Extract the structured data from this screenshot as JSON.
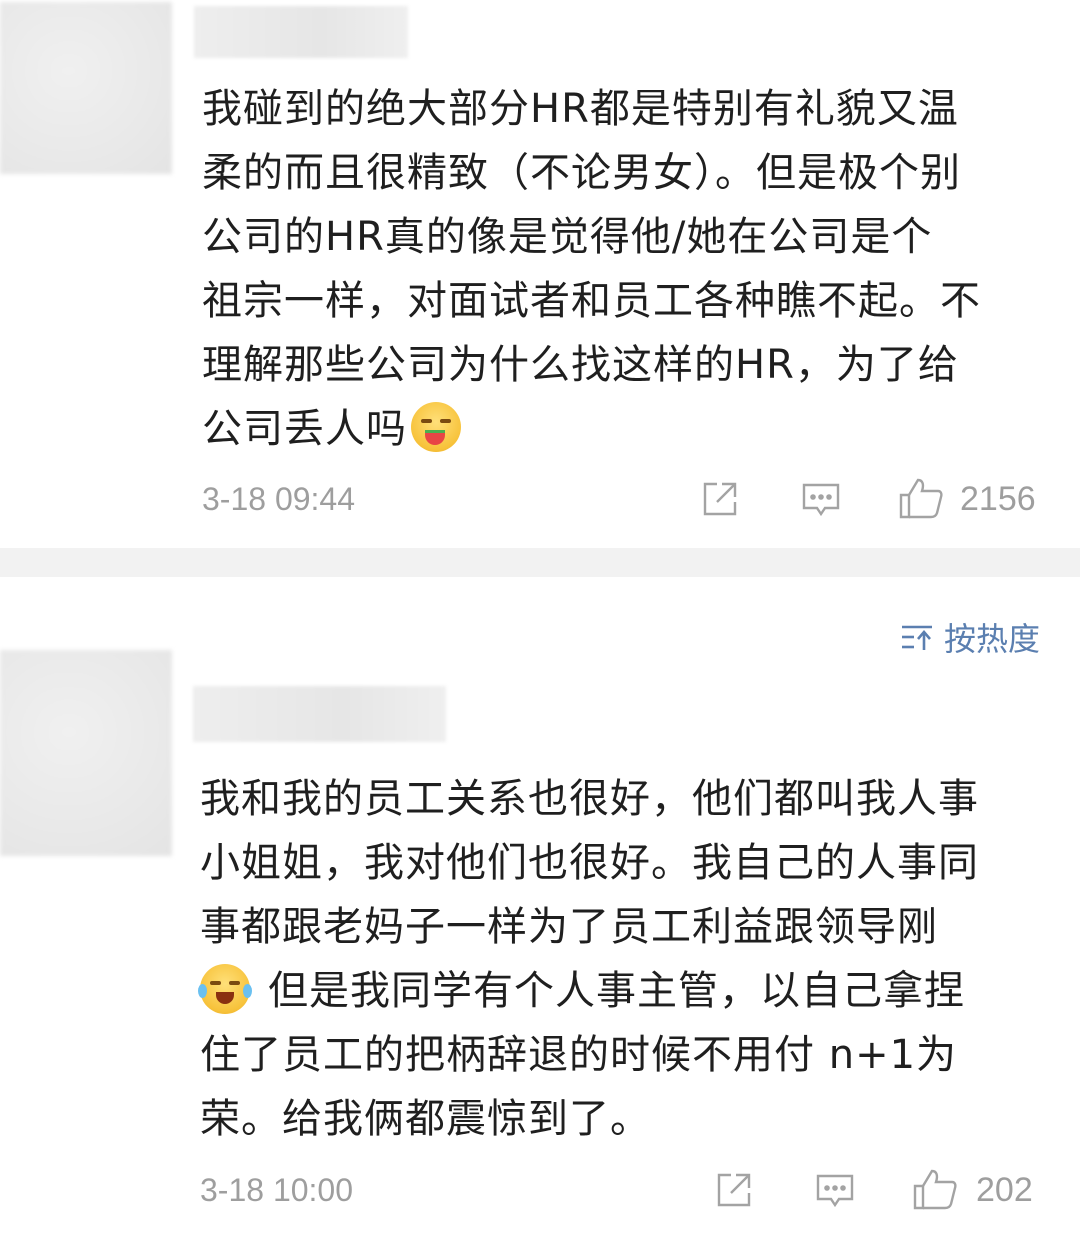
{
  "comments": [
    {
      "text_lines": [
        "我碰到的绝大部分HR都是特别有礼貌又温",
        "柔的而且很精致（不论男女）。但是极个别",
        "公司的HR真的像是觉得他/她在公司是个",
        "祖宗一样，对面试者和员工各种瞧不起。不",
        "理解那些公司为什么找这样的HR，为了给",
        "公司丢人吗"
      ],
      "emoji": "watermelon-face-emoji",
      "timestamp": "3-18 09:44",
      "likes": "2156"
    },
    {
      "text_lines": [
        "我和我的员工关系也很好，他们都叫我人事",
        "小姐姐，我对他们也很好。我自己的人事同",
        "事都跟老妈子一样为了员工利益跟领导刚",
        "但是我同学有个人事主管，以自己拿捏",
        "住了员工的把柄辞退的时候不用付 n+1为",
        "荣。给我俩都震惊到了。"
      ],
      "emoji": "tears-of-joy-emoji",
      "timestamp": "3-18 10:00",
      "likes": "202"
    }
  ],
  "sort": {
    "label": "按热度",
    "icon": "sort-icon"
  },
  "icons": {
    "share": "share-icon",
    "comment": "comment-icon",
    "like": "thumbs-up-icon"
  },
  "colors": {
    "text": "#1f1f1f",
    "meta": "#9e9e9e",
    "sort": "#5b7fb0",
    "separator": "#f2f2f2"
  }
}
